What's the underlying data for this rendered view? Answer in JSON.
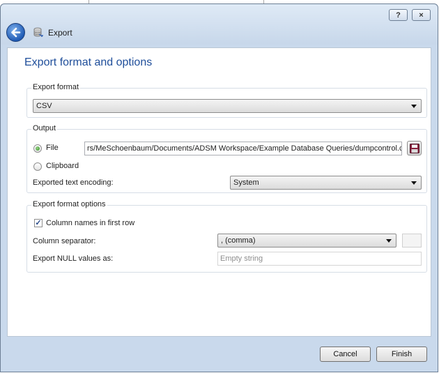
{
  "window": {
    "title": "Export",
    "help_label": "?",
    "close_label": "×"
  },
  "page": {
    "heading": "Export format and options"
  },
  "export_format": {
    "legend": "Export format",
    "selected": "CSV"
  },
  "output": {
    "legend": "Output",
    "file_label": "File",
    "file_path": "rs/MeSchoenbaum/Documents/ADSM Workspace/Example Database Queries/dumpcontrol.csv",
    "file_selected": true,
    "clipboard_label": "Clipboard",
    "encoding_label": "Exported text encoding:",
    "encoding_selected": "System"
  },
  "options": {
    "legend": "Export format options",
    "column_names_label": "Column names in first row",
    "column_names_checked": true,
    "check_mark": "✓",
    "separator_label": "Column separator:",
    "separator_selected": ", (comma)",
    "null_label": "Export NULL values as:",
    "null_placeholder": "Empty string"
  },
  "buttons": {
    "cancel": "Cancel",
    "finish": "Finish"
  },
  "colors": {
    "accent": "#1f4e9a",
    "frame": "#c9d9ec"
  }
}
